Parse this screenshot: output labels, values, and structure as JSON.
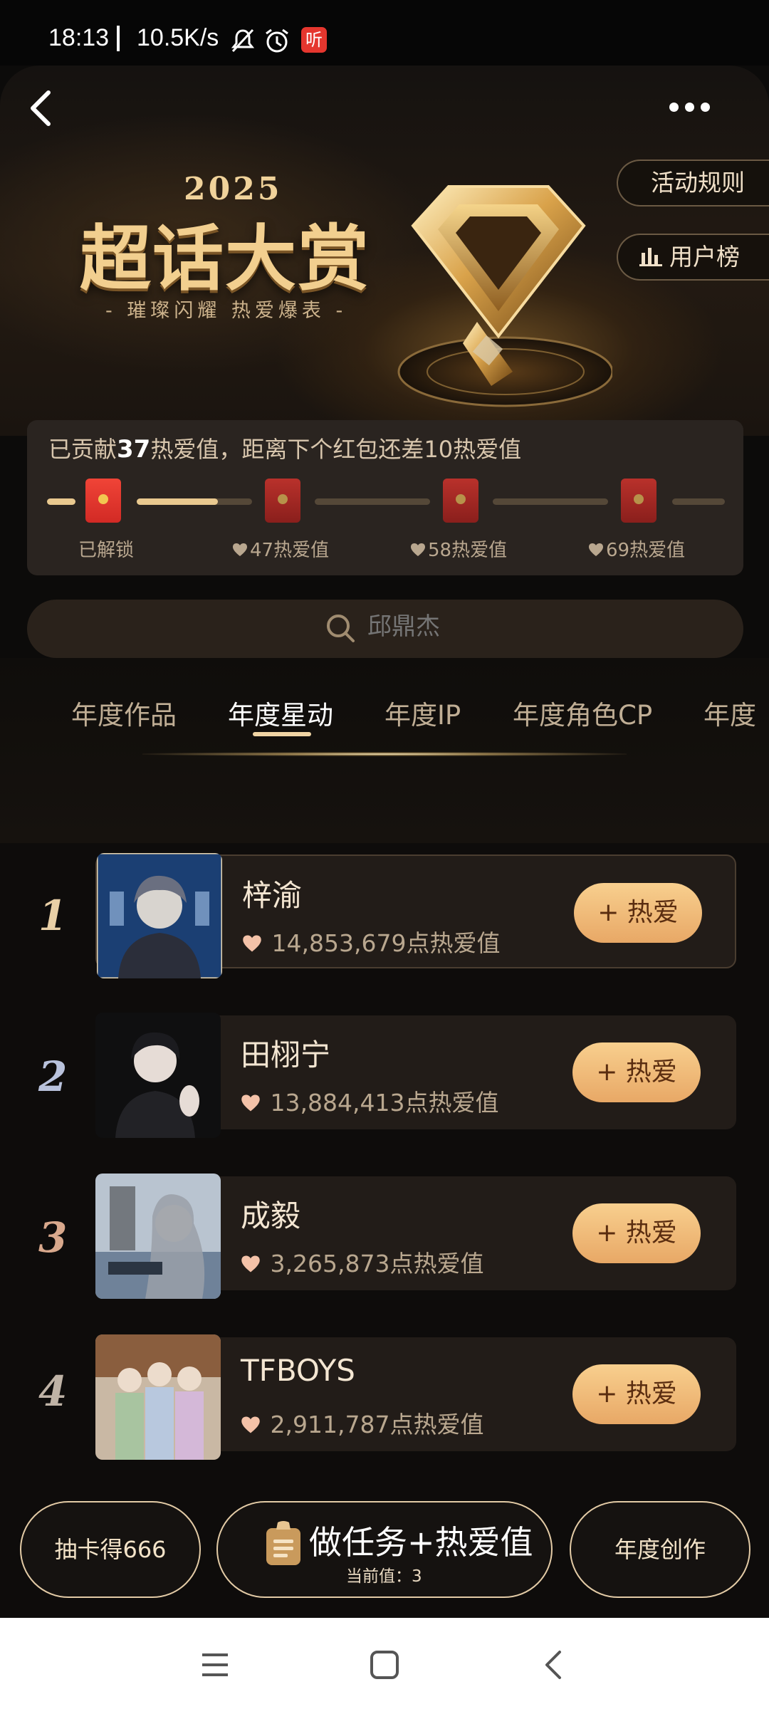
{
  "status_bar": {
    "time": "18:13",
    "net_speed": "10.5K/s",
    "icons": [
      "mute-bell-icon",
      "alarm-icon",
      "listen-badge-icon"
    ],
    "listen_badge": "听"
  },
  "banner": {
    "year": "2025",
    "title": "超话大赏",
    "slogan": "- 璀璨闪耀 热爱爆表 -",
    "rules_button": "活动规则",
    "users_rank_button": "用户榜"
  },
  "progress": {
    "text_prefix": "已贡献",
    "contributed": "37",
    "text_suffix": "热爱值，距离下个红包还差10热爱值",
    "value": 37,
    "milestones": [
      {
        "label": "已解锁",
        "unlocked": true
      },
      {
        "label": "47热爱值",
        "unlocked": false
      },
      {
        "label": "58热爱值",
        "unlocked": false
      },
      {
        "label": "69热爱值",
        "unlocked": false
      }
    ]
  },
  "search": {
    "placeholder": "邱鼎杰"
  },
  "tabs": [
    {
      "label": "年度作品",
      "active": false
    },
    {
      "label": "年度星动",
      "active": true
    },
    {
      "label": "年度IP",
      "active": false
    },
    {
      "label": "年度角色CP",
      "active": false
    },
    {
      "label": "年度",
      "active": false
    }
  ],
  "ranking": [
    {
      "rank": "1",
      "name": "梓渝",
      "score": "14,853,679点热爱值",
      "button": "+ 热爱",
      "rank_color": "#e8cfa6"
    },
    {
      "rank": "2",
      "name": "田栩宁",
      "score": "13,884,413点热爱值",
      "button": "+ 热爱",
      "rank_color": "#b9c2dc"
    },
    {
      "rank": "3",
      "name": "成毅",
      "score": "3,265,873点热爱值",
      "button": "+ 热爱",
      "rank_color": "#d8a88c"
    },
    {
      "rank": "4",
      "name": "TFBOYS",
      "score": "2,911,787点热爱值",
      "button": "+ 热爱",
      "rank_color": "#bfb3a6"
    }
  ],
  "bottom_actions": {
    "left": "抽卡得666",
    "task_title": "做任务+热爱值",
    "task_sub": "当前值：3",
    "right": "年度创作"
  },
  "colors": {
    "accent_gold": "#f2cf8f",
    "button_gradient_top": "#f8cf8e",
    "button_gradient_bottom": "#e8a866",
    "red_packet": "#e23a30"
  }
}
